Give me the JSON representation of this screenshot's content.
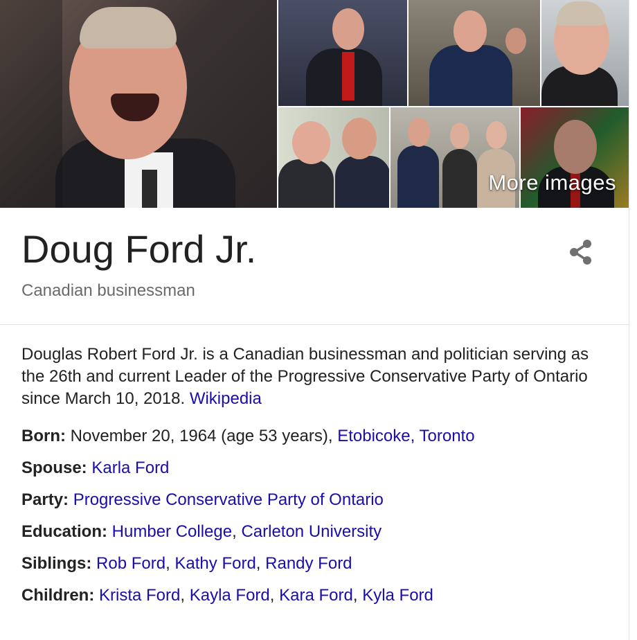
{
  "gallery": {
    "more_images_label": "More images"
  },
  "entity": {
    "title": "Doug Ford Jr.",
    "subtitle": "Canadian businessman"
  },
  "description": {
    "text": "Douglas Robert Ford Jr. is a Canadian businessman and politician serving as the 26th and current Leader of the Progressive Conservative Party of Ontario since March 10, 2018.",
    "source_link": "Wikipedia"
  },
  "facts": {
    "born": {
      "label": "Born:",
      "text": "November 20, 1964 (age 53 years),",
      "links": [
        "Etobicoke, Toronto"
      ]
    },
    "spouse": {
      "label": "Spouse:",
      "links": [
        "Karla Ford"
      ]
    },
    "party": {
      "label": "Party:",
      "links": [
        "Progressive Conservative Party of Ontario"
      ]
    },
    "education": {
      "label": "Education:",
      "links": [
        "Humber College",
        "Carleton University"
      ]
    },
    "siblings": {
      "label": "Siblings:",
      "links": [
        "Rob Ford",
        "Kathy Ford",
        "Randy Ford"
      ]
    },
    "children": {
      "label": "Children:",
      "links": [
        "Krista Ford",
        "Kayla Ford",
        "Kara Ford",
        "Kyla Ford"
      ]
    }
  },
  "icons": {
    "share": "share-icon"
  }
}
